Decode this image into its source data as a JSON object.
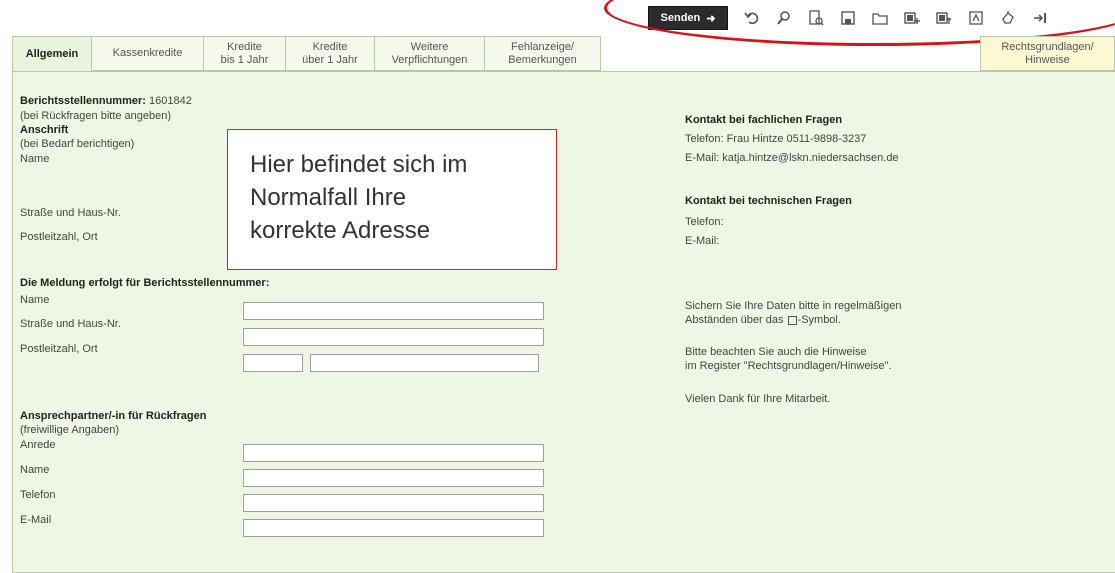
{
  "header": {
    "faded_title": ""
  },
  "toolbar": {
    "send_label": "Senden",
    "icons": [
      "undo-icon",
      "search-icon",
      "print-preview-icon",
      "save-icon",
      "open-folder-icon",
      "add-row-icon",
      "insert-row-icon",
      "pdf-icon",
      "hand-icon",
      "exit-icon"
    ]
  },
  "tabs": [
    {
      "label": "Allgemein"
    },
    {
      "label": "Kassenkredite"
    },
    {
      "label": "Kredite\nbis 1 Jahr"
    },
    {
      "label": "Kredite\nüber 1 Jahr"
    },
    {
      "label": "Weitere\nVerpflichtungen"
    },
    {
      "label": "Fehlanzeige/\nBemerkungen"
    },
    {
      "label": "Rechtsgrundlagen/\nHinweise"
    }
  ],
  "left": {
    "reporting_number_label": "Berichtsstellennummer:",
    "reporting_number_value": "1601842",
    "reporting_number_hint": "(bei Rückfragen bitte angeben)",
    "address_heading": "Anschrift",
    "address_hint": "(bei Bedarf berichtigen)",
    "name_label": "Name",
    "street_label": "Straße und Haus-Nr.",
    "postal_label": "Postleitzahl, Ort",
    "report_for_heading": "Die Meldung erfolgt für Berichtsstellennummer:",
    "rf_name_label": "Name",
    "rf_street_label": "Straße und Haus-Nr.",
    "rf_postal_label": "Postleitzahl, Ort",
    "contact_heading": "Ansprechpartner/-in für Rückfragen",
    "contact_hint": "(freiwillige Angaben)",
    "salutation_label": "Anrede",
    "c_name_label": "Name",
    "phone_label": "Telefon",
    "email_label": "E-Mail"
  },
  "overlay": {
    "line1": "Hier befindet sich im",
    "line2": "Normalfall Ihre",
    "line3": "korrekte Adresse"
  },
  "right": {
    "technical_contact_heading": "Kontakt bei fachlichen Fragen",
    "tc_phone": "Telefon: Frau Hintze  0511-9898-3237",
    "tc_email": "E-Mail:   katja.hintze@lskn.niedersachsen.de",
    "it_contact_heading": "Kontakt bei technischen Fragen",
    "it_phone": "Telefon:",
    "it_email": "E-Mail:",
    "save_note_1": "Sichern Sie Ihre Daten bitte in regelmäßigen",
    "save_note_2a": "Abständen über das",
    "save_note_2b": "-Symbol.",
    "hint_note_1": "Bitte beachten Sie auch die Hinweise",
    "hint_note_2": "im Register \"Rechtsgrundlagen/Hinweise\".",
    "thanks": "Vielen Dank für Ihre Mitarbeit."
  }
}
